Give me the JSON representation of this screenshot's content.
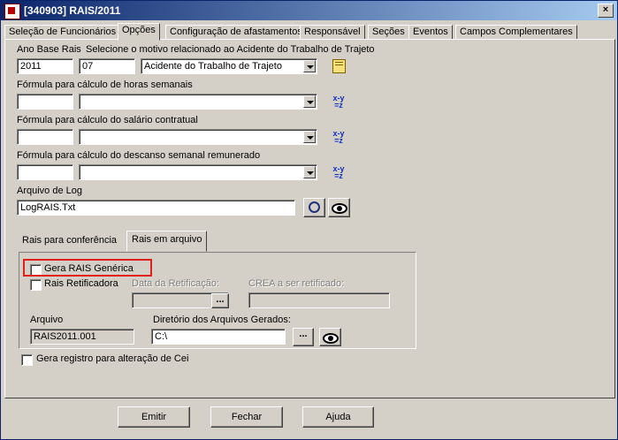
{
  "window": {
    "title": "[340903]  RAIS/2011",
    "close_glyph": "×"
  },
  "tabs": [
    "Seleção de Funcionários",
    "Opções",
    "Configuração de afastamentos",
    "Responsável",
    "Seções",
    "Eventos",
    "Campos Complementares"
  ],
  "form": {
    "ano_base_label": "Ano Base Rais",
    "ano_base_value": "2011",
    "motivo_label": "Selecione o motivo relacionado ao Acidente do Trabalho de Trajeto",
    "motivo_code": "07",
    "motivo_value": "Acidente do Trabalho de Trajeto",
    "horas_label": "Fórmula para cálculo de horas semanais",
    "salario_label": "Fórmula para cálculo do salário contratual",
    "descanso_label": "Fórmula para cálculo do descanso semanal remunerado",
    "formula_icon_text": "x-y =z",
    "log_label": "Arquivo de Log",
    "log_value": "LogRAIS.Txt"
  },
  "subtabs": [
    "Rais para conferência",
    "Rais em arquivo"
  ],
  "rais_arquivo": {
    "generica_label": "Gera RAIS Genérica",
    "retificadora_label": "Rais Retificadora",
    "data_retificacao_label": "Data da Retificação:",
    "crea_label": "CREA a ser retificado:",
    "arquivo_label": "Arquivo",
    "arquivo_value": "RAIS2011.001",
    "diretorio_label": "Diretório dos Arquivos Gerados:",
    "diretorio_value": "C:\\",
    "ellipsis": "..."
  },
  "gera_registro_label": "Gera registro para alteração de Cei",
  "buttons": {
    "emitir": "Emitir",
    "fechar": "Fechar",
    "ajuda": "Ajuda"
  },
  "colors": {
    "highlight_box": "#e0201c",
    "titlebar": "#0a246a"
  }
}
